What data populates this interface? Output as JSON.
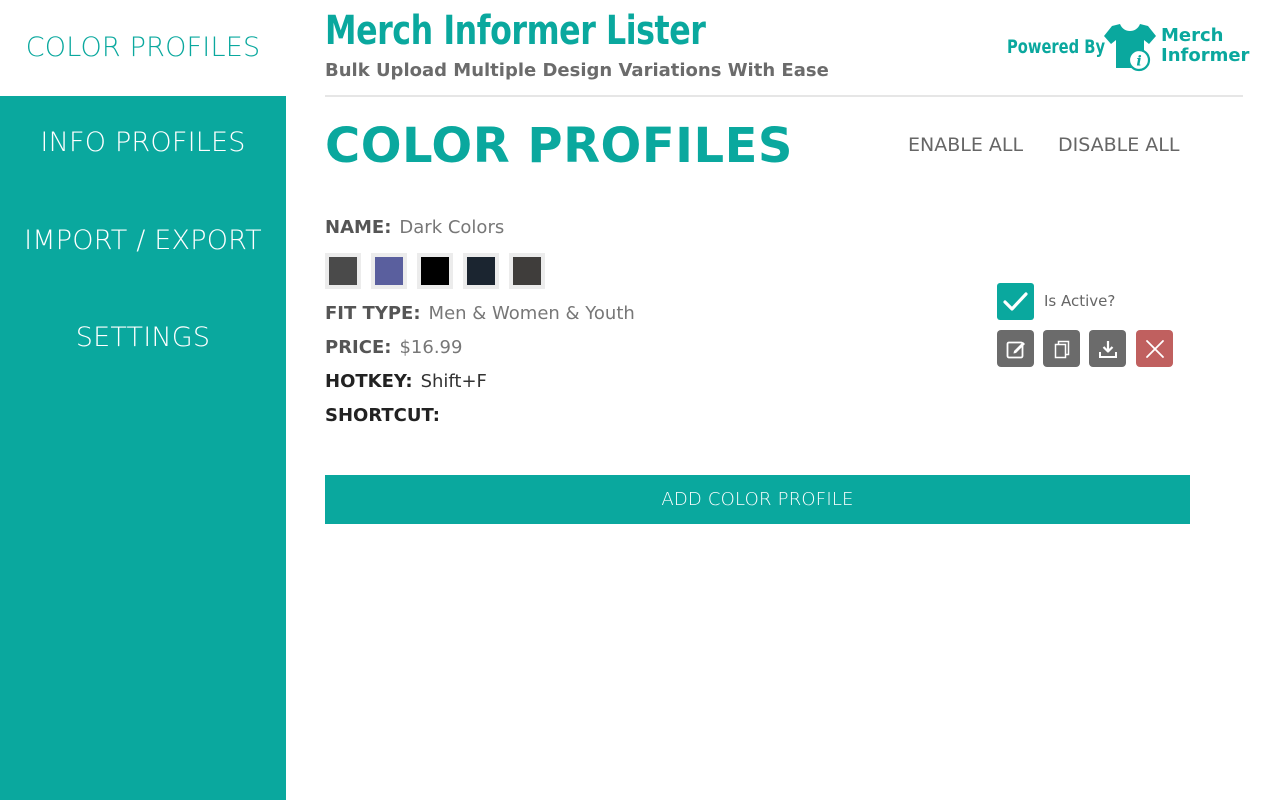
{
  "sidebar": {
    "items": [
      {
        "label": "COLOR PROFILES",
        "active": true
      },
      {
        "label": "INFO PROFILES"
      },
      {
        "label": "IMPORT / EXPORT"
      },
      {
        "label": "SETTINGS"
      }
    ]
  },
  "header": {
    "title": "Merch Informer Lister",
    "subtitle": "Bulk Upload Multiple Design Variations With Ease",
    "powered_by": "Powered By",
    "logo_line1": "Merch",
    "logo_line2": "Informer",
    "logo_icon": "tshirt-info-icon"
  },
  "main": {
    "title": "COLOR PROFILES",
    "enable_all": "ENABLE ALL",
    "disable_all": "DISABLE ALL"
  },
  "profile": {
    "name_label": "NAME:",
    "name_value": "Dark Colors",
    "swatch_colors": [
      "#4a4a4a",
      "#5a5f9e",
      "#000000",
      "#1b2530",
      "#3f3d3b"
    ],
    "fit_label": "FIT TYPE:",
    "fit_value": "Men & Women & Youth",
    "price_label": "PRICE:",
    "price_value": "$16.99",
    "hotkey_label": "HOTKEY:",
    "hotkey_value": "Shift+F",
    "shortcut_label": "SHORTCUT:",
    "shortcut_value": "",
    "is_active_label": "Is Active?",
    "is_active": true,
    "actions": [
      "edit-icon",
      "copy-icon",
      "download-icon",
      "close-icon"
    ]
  },
  "add_button_label": "ADD COLOR PROFILE",
  "colors": {
    "accent": "#0aa89e",
    "action_gray": "#6b6b6b",
    "danger": "#c0605f"
  }
}
